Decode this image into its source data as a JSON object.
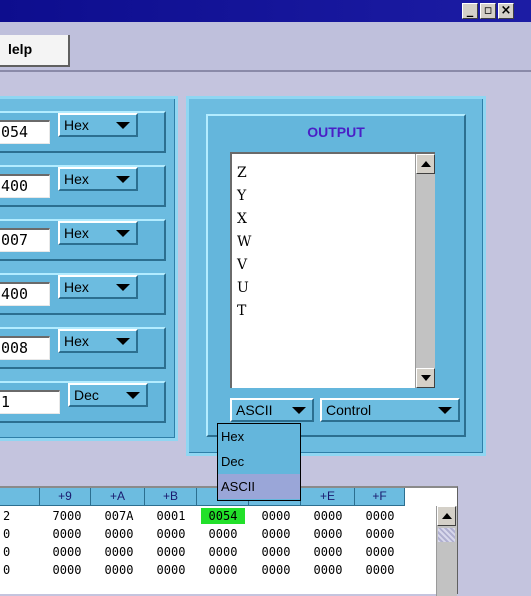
{
  "window": {
    "minimize_glyph": "_",
    "restore_glyph": "▫",
    "close_glyph": "×"
  },
  "menu": {
    "help_label": "lelp"
  },
  "registers": [
    {
      "value": "054",
      "format": "Hex"
    },
    {
      "value": "400",
      "format": "Hex"
    },
    {
      "value": "007",
      "format": "Hex"
    },
    {
      "value": "400",
      "format": "Hex"
    },
    {
      "value": "008",
      "format": "Hex"
    },
    {
      "value": "1",
      "format": "Dec"
    }
  ],
  "output": {
    "title": "OUTPUT",
    "lines": [
      "Z",
      "Y",
      "X",
      "W",
      "V",
      "U",
      "T"
    ],
    "format_selected": "ASCII",
    "mode_selected": "Control",
    "format_options": [
      "Hex",
      "Dec",
      "ASCII"
    ],
    "format_highlight": "ASCII"
  },
  "memory": {
    "headers": [
      "+9",
      "+A",
      "+B",
      "",
      "",
      "+E",
      "+F"
    ],
    "row_prefixes": [
      "2",
      "0",
      "0",
      "0"
    ],
    "rows": [
      [
        "7000",
        "007A",
        "0001",
        "0054",
        "0000",
        "0000",
        "0000"
      ],
      [
        "0000",
        "0000",
        "0000",
        "0000",
        "0000",
        "0000",
        "0000"
      ],
      [
        "0000",
        "0000",
        "0000",
        "0000",
        "0000",
        "0000",
        "0000"
      ],
      [
        "0000",
        "0000",
        "0000",
        "0000",
        "0000",
        "0000",
        "0000"
      ]
    ],
    "highlight_color": "#22e02a"
  },
  "colors": {
    "panel": "#6cbce0",
    "title_bar": "#0d0d8e",
    "title_text": "#4a1fc6"
  }
}
